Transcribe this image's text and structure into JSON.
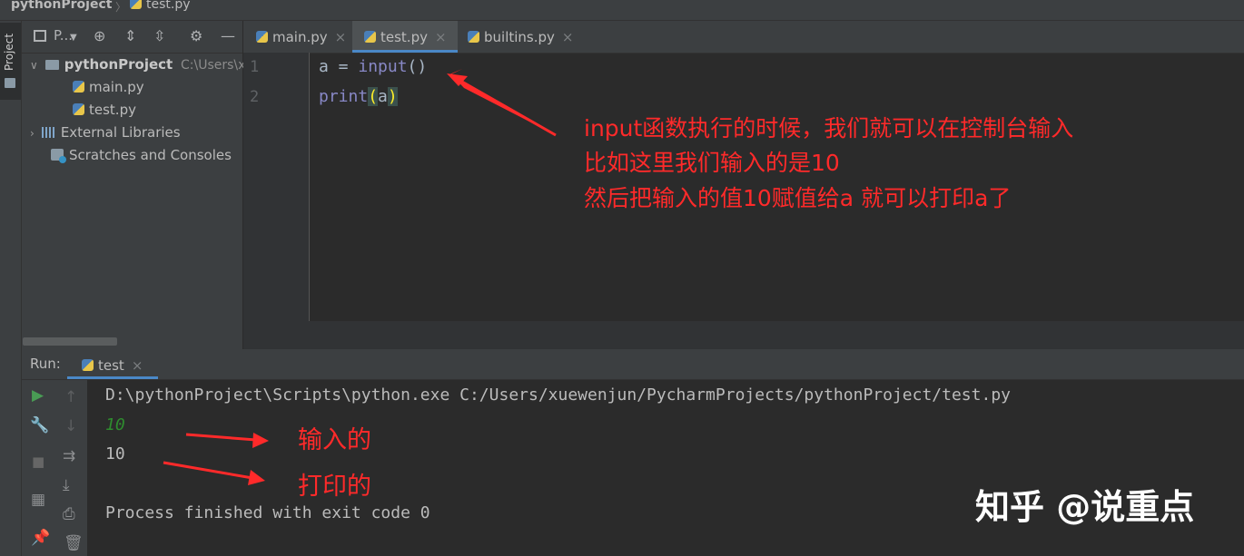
{
  "breadcrumb": {
    "project": "pythonProject",
    "separator": "〉",
    "file": "test.py"
  },
  "stripe": {
    "label": "Project"
  },
  "project_panel": {
    "title": "P...",
    "tree": [
      {
        "label": "pythonProject",
        "path": "C:\\Users\\x"
      },
      {
        "label": "main.py"
      },
      {
        "label": "test.py"
      },
      {
        "label": "External Libraries"
      },
      {
        "label": "Scratches and Consoles"
      }
    ]
  },
  "tabs": [
    {
      "label": "main.py",
      "close": "×"
    },
    {
      "label": "test.py",
      "close": "×"
    },
    {
      "label": "builtins.py",
      "close": "×"
    }
  ],
  "editor": {
    "lines": [
      {
        "number": "1",
        "pre": "a = ",
        "kw": "input",
        "post": "()"
      },
      {
        "number": "2",
        "kw": "print",
        "open": "(",
        "arg": "a",
        "close": ")"
      }
    ]
  },
  "annotations": {
    "top": [
      "input函数执行的时候，我们就可以在控制台输入",
      "比如这里我们输入的是10",
      "然后把输入的值10赋值给a 就可以打印a了"
    ],
    "input_label": "输入的",
    "print_label": "打印的",
    "color": "#ff2a2a"
  },
  "run": {
    "label": "Run:",
    "tab": "test",
    "tab_close": "×",
    "command": "D:\\pythonProject\\Scripts\\python.exe C:/Users/xuewenjun/PycharmProjects/pythonProject/test.py",
    "input_echo": "10",
    "output": "10",
    "finished": "Process finished with exit code 0"
  },
  "watermark": "知乎 @说重点",
  "colors": {
    "accent": "#4a88c7",
    "bg": "#2b2b2b",
    "panel": "#3c3f41"
  }
}
